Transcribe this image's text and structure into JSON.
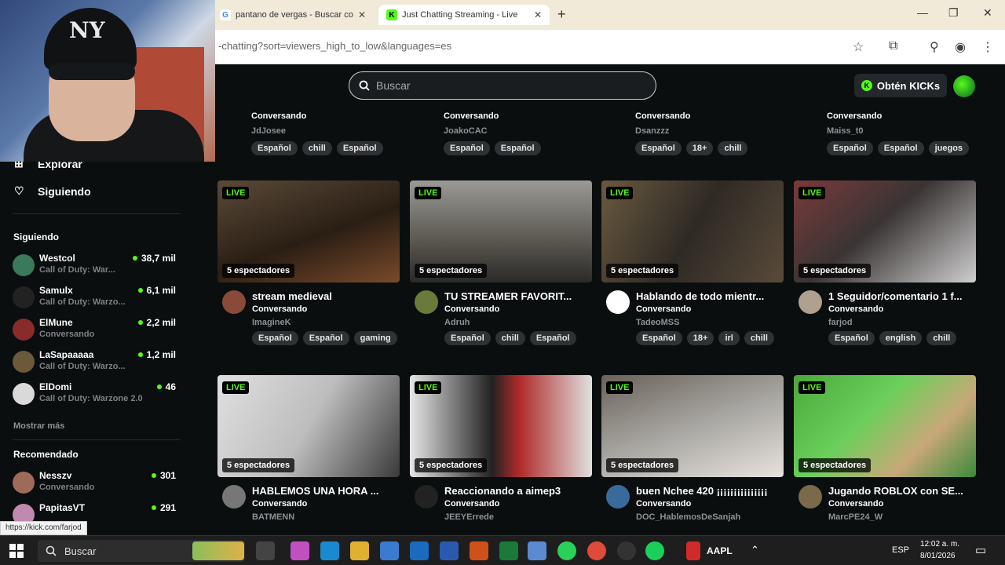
{
  "browser": {
    "tabs": [
      {
        "title": "pantano de vergas - Buscar con"
      },
      {
        "title": "Just Chatting Streaming - Live"
      }
    ],
    "url": "-chatting?sort=viewers_high_to_low&languages=es",
    "status_url": "https://kick.com/farjod"
  },
  "header": {
    "search_placeholder": "Buscar",
    "get_kicks_label": "Obtén KICKs"
  },
  "sidebar": {
    "nav": [
      {
        "label": "Explorar"
      },
      {
        "label": "Siguiendo"
      }
    ],
    "following_title": "Siguiendo",
    "following": [
      {
        "name": "Westcol",
        "category": "Call of Duty: War...",
        "viewers": "38,7 mil",
        "color": "#3a7a5a"
      },
      {
        "name": "Samulx",
        "category": "Call of Duty: Warzo...",
        "viewers": "6,1 mil",
        "color": "#222222"
      },
      {
        "name": "ElMune",
        "category": "Conversando",
        "viewers": "2,2 mil",
        "color": "#8a2b2b"
      },
      {
        "name": "LaSapaaaaa",
        "category": "Call of Duty: Warzo...",
        "viewers": "1,2 mil",
        "color": "#6a5a3a"
      },
      {
        "name": "ElDomi",
        "category": "Call of Duty: Warzone 2.0",
        "viewers": "46",
        "color": "#d9d9d9"
      }
    ],
    "show_more": "Mostrar más",
    "recommended_title": "Recomendado",
    "recommended": [
      {
        "name": "Nesszv",
        "category": "Conversando",
        "viewers": "301",
        "color": "#a06a5a"
      },
      {
        "name": "PapitasVT",
        "category": "",
        "viewers": "291",
        "color": "#c08ab0"
      }
    ]
  },
  "top_row": [
    {
      "category": "Conversando",
      "name": "JdJosee",
      "tags": [
        "Español",
        "chill",
        "Español"
      ]
    },
    {
      "category": "Conversando",
      "name": "JoakoCAC",
      "tags": [
        "Español",
        "Español"
      ]
    },
    {
      "category": "Conversando",
      "name": "Dsanzzz",
      "tags": [
        "Español",
        "18+",
        "chill"
      ]
    },
    {
      "category": "Conversando",
      "name": "Maiss_t0",
      "tags": [
        "Español",
        "Español",
        "juegos"
      ]
    }
  ],
  "streams": [
    {
      "title": "stream medieval",
      "category": "Conversando",
      "name": "ImagineK",
      "viewers": "5 espectadores",
      "tags": [
        "Español",
        "Español",
        "gaming"
      ],
      "thumb": "#4a3a2a",
      "avatar": "#8a4a3a"
    },
    {
      "title": "TU STREAMER FAVORIT...",
      "category": "Conversando",
      "name": "Adruh",
      "viewers": "5 espectadores",
      "tags": [
        "Español",
        "chill",
        "Español"
      ],
      "thumb": "#6f6a60",
      "avatar": "#6a7a3a"
    },
    {
      "title": "Hablando de todo mientr...",
      "category": "Conversando",
      "name": "TadeoMSS",
      "viewers": "5 espectadores",
      "tags": [
        "Español",
        "18+",
        "irl",
        "chill"
      ],
      "thumb": "#3f3a33",
      "avatar": "#ffffff"
    },
    {
      "title": "1 Seguidor/comentario 1 f...",
      "category": "Conversando",
      "name": "farjod",
      "viewers": "5 espectadores",
      "tags": [
        "Español",
        "english",
        "chill"
      ],
      "thumb": "#7a3a3a",
      "avatar": "#b0a090"
    },
    {
      "title": "HABLEMOS UNA HORA ...",
      "category": "Conversando",
      "name": "BATMENN",
      "viewers": "5 espectadores",
      "tags": [],
      "thumb": "#cfcfcf",
      "avatar": "#777777"
    },
    {
      "title": "Reaccionando a aimep3",
      "category": "Conversando",
      "name": "JEEYErrede",
      "viewers": "5 espectadores",
      "tags": [],
      "thumb": "#d8d8d8",
      "avatar": "#222222"
    },
    {
      "title": "buen Nchee 420 ¡¡¡¡¡¡¡¡¡¡¡¡¡¡¡",
      "category": "Conversando",
      "name": "DOC_HablemosDeSanjah",
      "viewers": "5 espectadores",
      "tags": [],
      "thumb": "#8a8884",
      "avatar": "#3a6a9a"
    },
    {
      "title": "Jugando ROBLOX con SE...",
      "category": "Conversando",
      "name": "MarcPE24_W",
      "viewers": "5 espectadores",
      "tags": [],
      "thumb": "#5ac04a",
      "avatar": "#7a6a4a"
    }
  ],
  "live_label": "LIVE",
  "taskbar": {
    "search_placeholder": "Buscar",
    "ticker": "AAPL",
    "lang": "ESP",
    "time": "12:02 a. m.",
    "date": "8/01/2026"
  }
}
